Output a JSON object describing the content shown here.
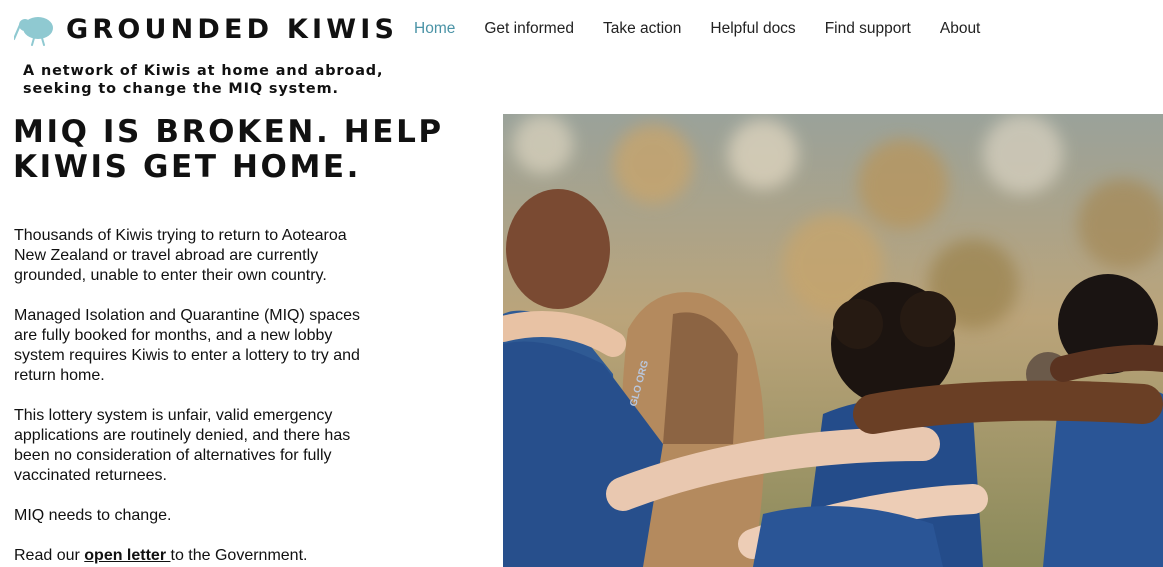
{
  "header": {
    "logo_icon": "kiwi-bird-icon",
    "brand": "GROUNDED KIWIS",
    "tagline_lines": [
      "A network of Kiwis at home and abroad,",
      "seeking to change the MIQ system."
    ]
  },
  "nav": {
    "items": [
      {
        "label": "Home",
        "active": true
      },
      {
        "label": "Get informed",
        "active": false
      },
      {
        "label": "Take action",
        "active": false
      },
      {
        "label": "Helpful docs",
        "active": false
      },
      {
        "label": "Find support",
        "active": false
      },
      {
        "label": "About",
        "active": false
      }
    ]
  },
  "main": {
    "headline_lines": [
      "MIQ IS BROKEN. HELP",
      "KIWIS GET HOME."
    ],
    "paragraphs": [
      [
        "Thousands of Kiwis trying to return to Aotearoa",
        "New Zealand or travel abroad are currently",
        "grounded, unable to enter their own country."
      ],
      [
        "Managed Isolation and Quarantine (MIQ) spaces",
        "are fully booked for months, and a new lobby",
        "system requires Kiwis to enter a lottery to try and",
        "return home."
      ],
      [
        "This lottery system is unfair, valid emergency",
        "applications are routinely denied, and there has",
        "been no consideration of alternatives for fully",
        "vaccinated returnees."
      ],
      [
        "MIQ needs to change."
      ]
    ],
    "cta": {
      "prefix": "Read our ",
      "link": "open letter ",
      "suffix": "to the Government."
    }
  },
  "hero": {
    "image": "group-of-people-embracing-photo",
    "shirt_text": "GLO ORG"
  },
  "colors": {
    "accent": "#4a93a6",
    "logo": "#8fc9d1",
    "text": "#111111",
    "shirt": "#274f8c"
  }
}
